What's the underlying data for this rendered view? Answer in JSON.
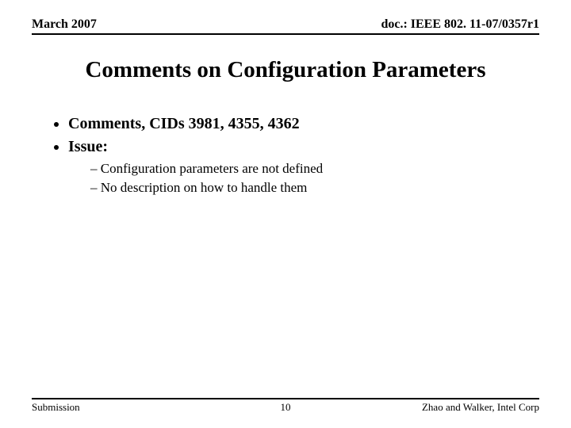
{
  "header": {
    "left": "March 2007",
    "right": "doc.: IEEE 802. 11-07/0357r1"
  },
  "title": "Comments on Configuration Parameters",
  "bullets": {
    "item0": "Comments, CIDs 3981, 4355, 4362",
    "item1": "Issue:",
    "sub": {
      "s0": "Configuration parameters are not defined",
      "s1": "No description on how to handle them"
    }
  },
  "footer": {
    "left": "Submission",
    "center": "10",
    "right": "Zhao and Walker, Intel Corp"
  }
}
